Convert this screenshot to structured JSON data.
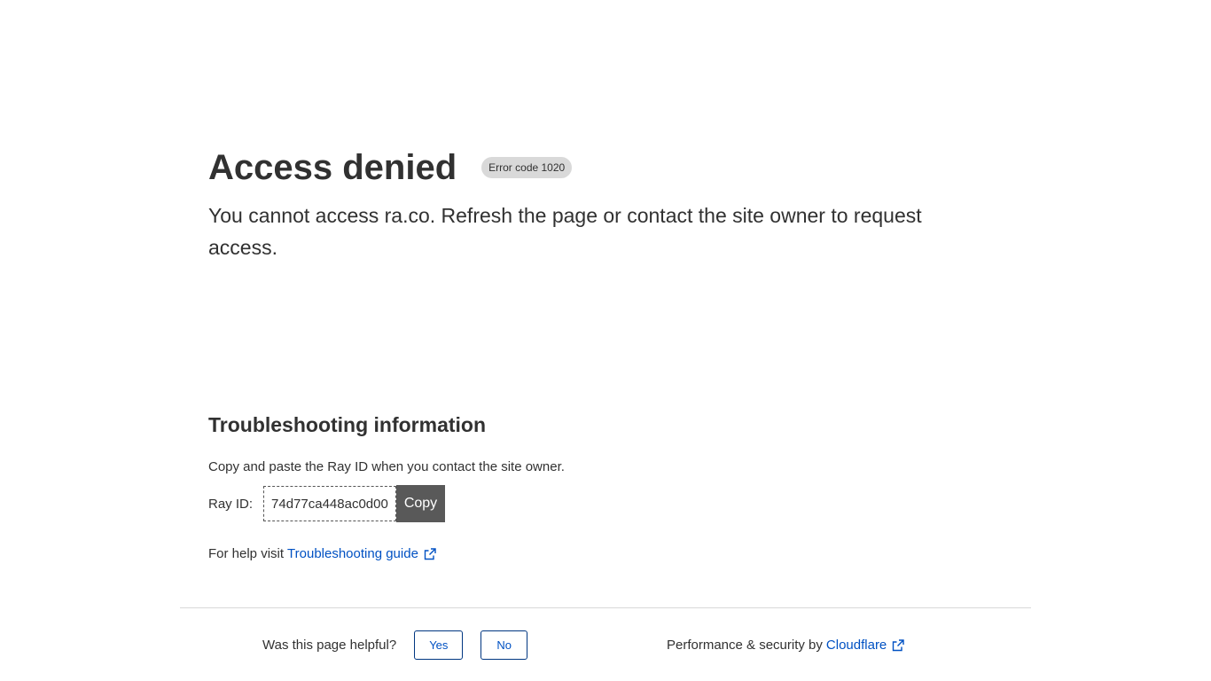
{
  "main": {
    "title": "Access denied",
    "error_badge": "Error code 1020",
    "subtitle": "You cannot access ra.co. Refresh the page or contact the site owner to request access."
  },
  "troubleshooting": {
    "heading": "Troubleshooting information",
    "hint": "Copy and paste the Ray ID when you contact the site owner.",
    "ray_label": "Ray ID:",
    "ray_value": "74d77ca448ac0d00",
    "copy_label": "Copy",
    "help_prefix": "For help visit",
    "help_link": "Troubleshooting guide"
  },
  "footer": {
    "feedback_question": "Was this page helpful?",
    "yes_label": "Yes",
    "no_label": "No",
    "perf_prefix": "Performance & security by",
    "cloudflare_link": "Cloudflare"
  },
  "icons": {
    "external_link": "external-link-icon"
  },
  "colors": {
    "link": "#0051c3",
    "text": "#313131",
    "badge_bg": "#d9d9d9",
    "copy_bg": "#595959"
  }
}
